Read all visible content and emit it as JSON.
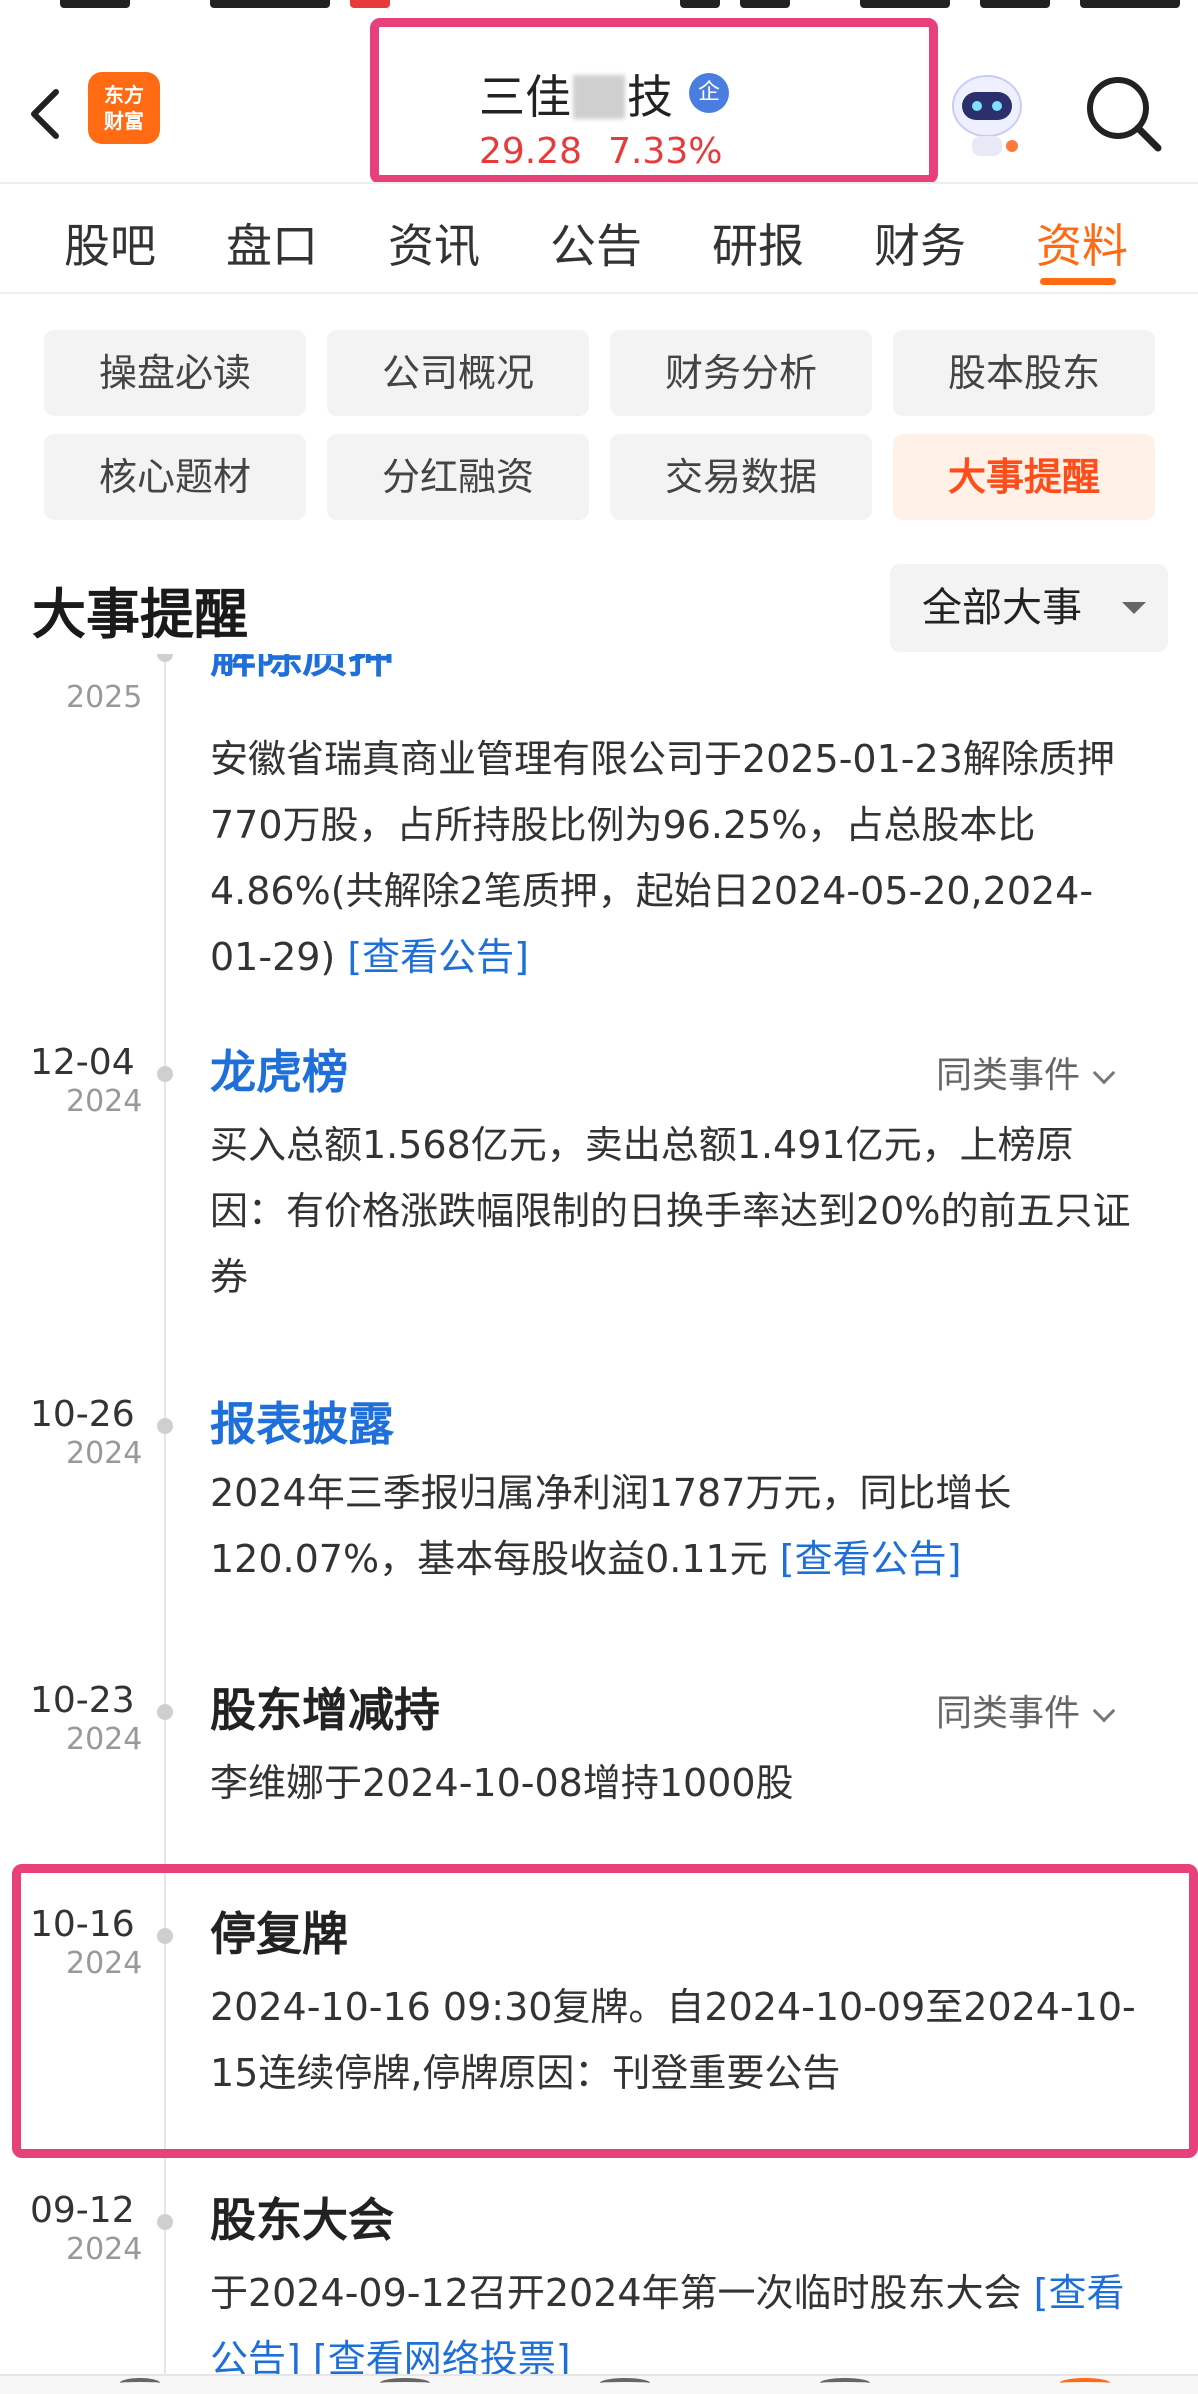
{
  "header": {
    "logo_line1": "东方",
    "logo_line2": "财富",
    "stock_name_prefix": "三佳",
    "stock_name_suffix": "技",
    "badge": "企",
    "price": "29.28",
    "change_pct": "7.33%"
  },
  "tabs": [
    "股吧",
    "盘口",
    "资讯",
    "公告",
    "研报",
    "财务",
    "资料"
  ],
  "subnav": [
    "操盘必读",
    "公司概况",
    "财务分析",
    "股本股东",
    "核心题材",
    "分红融资",
    "交易数据",
    "大事提醒"
  ],
  "section": {
    "title": "大事提醒",
    "filter_label": "全部大事"
  },
  "events": [
    {
      "date": "",
      "year": "2025",
      "title": "解除质押",
      "body": "安徽省瑞真商业管理有限公司于2025-01-23解除质押770万股，占所持股比例为96.25%，占总股本比4.86%(共解除2笔质押，起始日2024-05-20,2024-01-29)",
      "link": "[查看公告]"
    },
    {
      "date": "12-04",
      "year": "2024",
      "title": "龙虎榜",
      "similar": "同类事件",
      "body": "买入总额1.568亿元，卖出总额1.491亿元，上榜原因：有价格涨跌幅限制的日换手率达到20%的前五只证券"
    },
    {
      "date": "10-26",
      "year": "2024",
      "title": "报表披露",
      "body": "2024年三季报归属净利润1787万元，同比增长120.07%，基本每股收益0.11元",
      "link": "[查看公告]"
    },
    {
      "date": "10-23",
      "year": "2024",
      "title": "股东增减持",
      "similar": "同类事件",
      "body": "李维娜于2024-10-08增持1000股"
    },
    {
      "date": "10-16",
      "year": "2024",
      "title": "停复牌",
      "body": "2024-10-16 09:30复牌。自2024-10-09至2024-10-15连续停牌,停牌原因：刊登重要公告"
    },
    {
      "date": "09-12",
      "year": "2024",
      "title": "股东大会",
      "body": "于2024-09-12召开2024年第一次临时股东大会",
      "link": "[查看公告]",
      "link2": "[查看网络投票]"
    }
  ]
}
